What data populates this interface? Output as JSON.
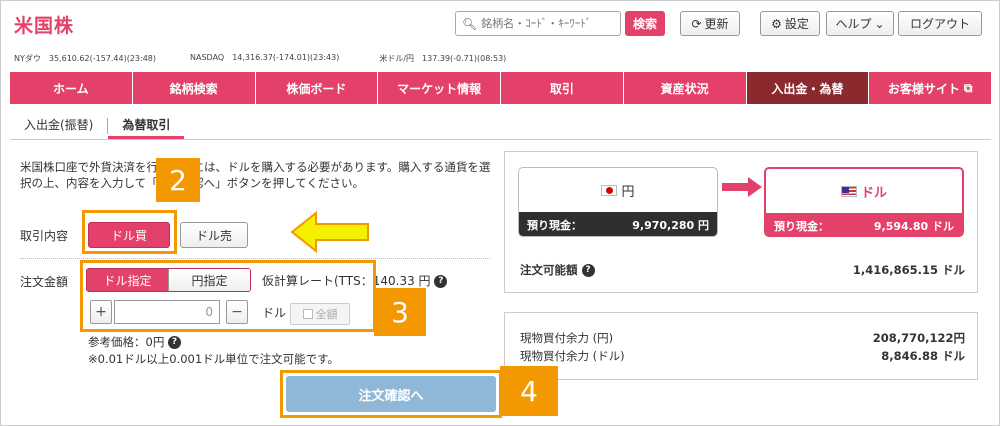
{
  "header": {
    "logo": "米国株",
    "search_placeholder": "銘柄名・ｺｰﾄﾞ・ｷｰﾜｰﾄﾞ",
    "search_button": "検索",
    "refresh": "更新",
    "settings": "設定",
    "help": "ヘルプ",
    "logout": "ログアウト"
  },
  "ticker": [
    {
      "name": "NYダウ",
      "value": "35,610.62(-157.44)(23:48)"
    },
    {
      "name": "NASDAQ",
      "value": "14,316.37(-174.01)(23:43)"
    },
    {
      "name": "米ドル/円",
      "value": "137.39(-0.71)(08:53)"
    }
  ],
  "nav": [
    "ホーム",
    "銘柄検索",
    "株価ボード",
    "マーケット情報",
    "取引",
    "資産状況",
    "入出金・為替",
    "お客様サイト"
  ],
  "subtabs": [
    "入出金(振替)",
    "為替取引"
  ],
  "description": "米国株口座で外貨決済を行うためには、ドルを購入する必要があります。購入する通貨を選択の上、内容を入力して「注文確認へ」ボタンを押してください。",
  "form": {
    "trade_label": "取引内容",
    "buy": "ドル買",
    "sell": "ドル売",
    "amount_label": "注文金額",
    "usd_mode": "ドル指定",
    "jpy_mode": "円指定",
    "rate_text": "仮計算レート(TTS：140.33 円",
    "qty_value": "0",
    "unit": "ドル",
    "all": "全額",
    "ref_price": "参考価格：0円",
    "note": "※0.01ドル以上0.001ドル単位で注文可能です。",
    "confirm": "注文確認へ"
  },
  "markers": [
    "2",
    "3",
    "4"
  ],
  "right": {
    "jpy_card": {
      "currency": "円",
      "label": "預り現金：",
      "value": "9,970,280 円"
    },
    "usd_card": {
      "currency": "ドル",
      "label": "預り現金：",
      "value": "9,594.80 ドル"
    },
    "orderable_label": "注文可能額",
    "orderable_value": "1,416,865.15 ドル",
    "buying_power_jpy_label": "現物買付余力 (円)",
    "buying_power_jpy_value": "208,770,122円",
    "buying_power_usd_label": "現物買付余力 (ドル)",
    "buying_power_usd_value": "8,846.88 ドル"
  },
  "colors": {
    "brand": "#e4416a",
    "nav_active": "#8a2a2e",
    "marker": "#f39800",
    "confirm": "#8fb8d8"
  }
}
